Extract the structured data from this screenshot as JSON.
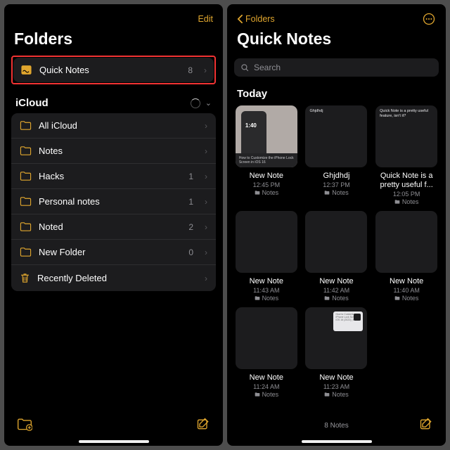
{
  "left": {
    "edit": "Edit",
    "title": "Folders",
    "quicknotes": {
      "label": "Quick Notes",
      "count": "8"
    },
    "section": "iCloud",
    "rows": [
      {
        "label": "All iCloud",
        "count": ""
      },
      {
        "label": "Notes",
        "count": ""
      },
      {
        "label": "Hacks",
        "count": "1"
      },
      {
        "label": "Personal notes",
        "count": "1"
      },
      {
        "label": "Noted",
        "count": "2"
      },
      {
        "label": "New Folder",
        "count": "0"
      },
      {
        "label": "Recently Deleted",
        "count": ""
      }
    ]
  },
  "right": {
    "back": "Folders",
    "title": "Quick Notes",
    "search": "Search",
    "today": "Today",
    "footer": "8 Notes",
    "notes_location": "Notes",
    "cards": [
      {
        "title": "New Note",
        "time": "12:45 PM",
        "thumb": "lockscreen",
        "thumbText": "1:40",
        "caption": "How to Customize the iPhone Lock Screen in iOS 16"
      },
      {
        "title": "Ghjdhdj",
        "time": "12:37 PM",
        "thumb": "text",
        "text": "Ghjdhdj"
      },
      {
        "title": "Quick Note is a pretty useful f...",
        "titleFull": "Quick Note is a pretty useful feature, isn't it?",
        "time": "12:05 PM",
        "thumb": "text",
        "text": "Quick Note is a pretty useful feature, isn't it?"
      },
      {
        "title": "New Note",
        "time": "11:43 AM",
        "thumb": "blank"
      },
      {
        "title": "New Note",
        "time": "11:42 AM",
        "thumb": "blank"
      },
      {
        "title": "New Note",
        "time": "11:40 AM",
        "thumb": "blank"
      },
      {
        "title": "New Note",
        "time": "11:24 AM",
        "thumb": "blank"
      },
      {
        "title": "New Note",
        "time": "11:23 AM",
        "thumb": "minibox",
        "miniText": "How to Customize iPhone Lock Screen in iOS 16 (2022) | Beeb..."
      }
    ]
  }
}
